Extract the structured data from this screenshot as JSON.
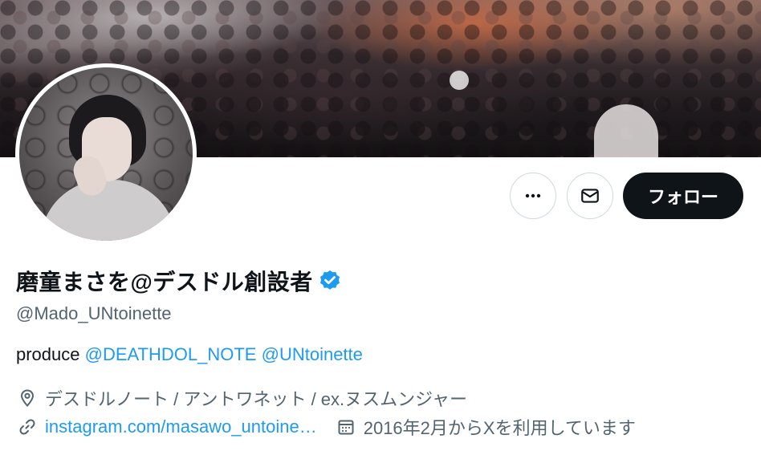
{
  "profile": {
    "display_name": "磨童まさを@デスドル創設者",
    "handle": "@Mado_UNtoinette",
    "verified": true,
    "bio_prefix": "produce ",
    "bio_mentions": [
      "@DEATHDOL_NOTE",
      "@UNtoinette"
    ],
    "location": "デスドルノート / アントワネット / ex.ヌスムンジャー",
    "website": "instagram.com/masawo_untoine…",
    "joined": "2016年2月からXを利用しています"
  },
  "actions": {
    "more_icon": "more-icon",
    "dm_icon": "envelope-icon",
    "follow_label": "フォロー"
  },
  "colors": {
    "accent": "#1d9bf0",
    "text": "#0f1419",
    "muted": "#536471",
    "follow_bg": "#0f1419"
  }
}
